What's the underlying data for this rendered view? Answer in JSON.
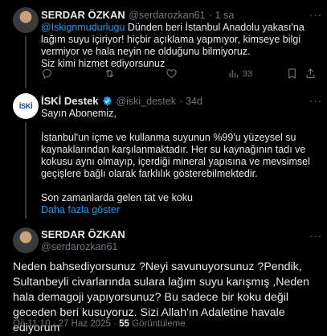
{
  "tweet1": {
    "name": "SERDAR ÖZKAN",
    "handle": "@serdarozkan61",
    "time": "· 1 sa",
    "mention": "@Iskignmudurlugu",
    "text_after_mention": " Dünden beri İstanbul Anadolu yakası'na lağım suyu içiriyor! hiçbir açıklama yapmıyor, kimseye bilgi vermiyor ve hala neyin ne olduğunu bilmiyoruz.",
    "text_line2": "Siz kimi hizmet ediyorsunuz",
    "views": "33",
    "icons": [
      "reply-icon",
      "retweet-icon",
      "like-icon",
      "views-icon",
      "bookmark-icon",
      "share-icon"
    ]
  },
  "tweet2": {
    "name": "İSKİ Destek",
    "handle": "@iski_destek",
    "time": "· 34d",
    "logo_text": "İSKİ",
    "p1": "Sayın Abonemiz,",
    "p2": "İstanbul'un içme ve kullanma suyunun %99'u yüzeysel su kaynaklarından karşılanmaktadır. Her su kaynağının tadı ve kokusu aynı olmayıp, içerdiği mineral yapısına ve mevsimsel geçişlere bağlı olarak farklılık gösterebilmektedir.",
    "p3": "Son zamanlarda gelen tat ve koku",
    "more": "Daha fazla göster"
  },
  "tweet3": {
    "name": "SERDAR ÖZKAN",
    "handle": "@serdarozkan61",
    "text": "Neden bahsediyorsunuz ?Neyi savunuyorsunuz ?Pendik, Sultanbeyli civarlarında sulara lağım suyu karışmış ,Neden hala demagoji yapıyorsunuz? Bu sadece bir koku değil geceden beri kusuyoruz. Sizi Allah'ın Adaletine havale ediyorum",
    "meta_time": "Öö 11:10 · 27 Haz 2025 · ",
    "meta_views_count": "55",
    "meta_views_label": " Görüntüleme"
  },
  "colors": {
    "link": "#1d9bf0",
    "muted": "#71767b",
    "background": "#000000",
    "text": "#e7e9ea"
  }
}
